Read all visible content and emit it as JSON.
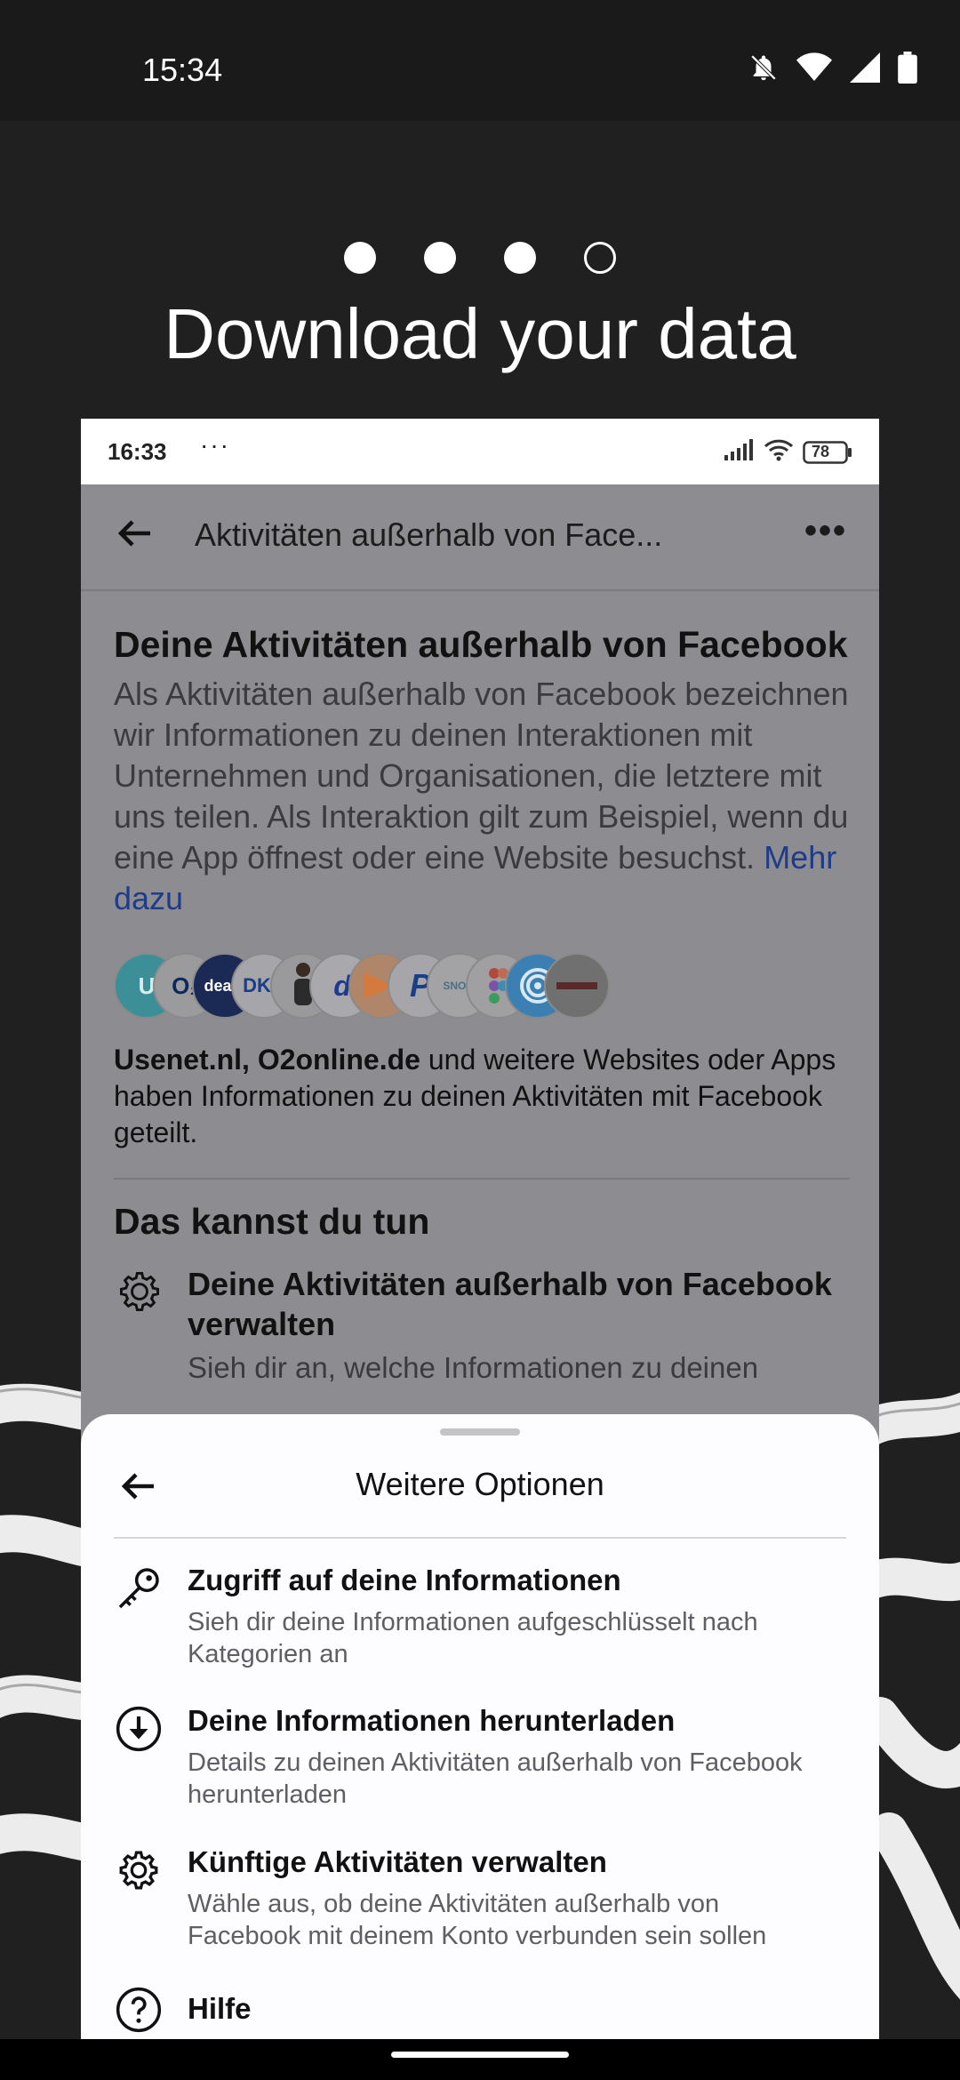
{
  "status_bar": {
    "time": "15:34"
  },
  "onboarding": {
    "page_indicator": {
      "filled": 3,
      "total": 4
    },
    "headline": "Download your data"
  },
  "inner_phone": {
    "status": {
      "time": "16:33",
      "more": "···",
      "battery": "78"
    },
    "header": {
      "title": "Aktivitäten außerhalb von Face..."
    },
    "content": {
      "heading": "Deine Aktivitäten außerhalb von Facebook",
      "description": "Als Aktivitäten außerhalb von Facebook bezeichnen wir Informationen zu deinen Interaktionen mit Unternehmen und Organisationen, die letztere mit uns teilen. Als Interaktion gilt zum Beispiel, wenn du eine App öffnest oder eine Website besuchst.",
      "more_link": "Mehr dazu",
      "logos": [
        "U",
        "O₂",
        "dealo",
        "DKB",
        "",
        "d",
        "",
        "P",
        "SNOW",
        "",
        "",
        ""
      ],
      "sites_bold": "Usenet.nl, O2online.de",
      "sites_rest": " und weitere Websites oder Apps haben Informationen zu deinen Aktivitäten mit Facebook geteilt.",
      "section_title": "Das kannst du tun",
      "manage_title": "Deine Aktivitäten außerhalb von Facebook verwalten",
      "manage_sub_partial": "Sieh dir an, welche Informationen zu deinen"
    },
    "sheet": {
      "title": "Weitere Optionen",
      "options": [
        {
          "icon": "key-icon",
          "title": "Zugriff auf deine Informationen",
          "subtitle": "Sieh dir deine Informationen aufgeschlüsselt nach Kategorien an"
        },
        {
          "icon": "download-icon",
          "title": "Deine Informationen herunterladen",
          "subtitle": "Details zu deinen Aktivitäten außerhalb von Facebook herunterladen"
        },
        {
          "icon": "gear-icon",
          "title": "Künftige Aktivitäten verwalten",
          "subtitle": "Wähle aus, ob deine Aktivitäten außerhalb von Facebook mit deinem Konto verbunden sein sollen"
        },
        {
          "icon": "help-icon",
          "title": "Hilfe",
          "subtitle": ""
        }
      ]
    }
  }
}
